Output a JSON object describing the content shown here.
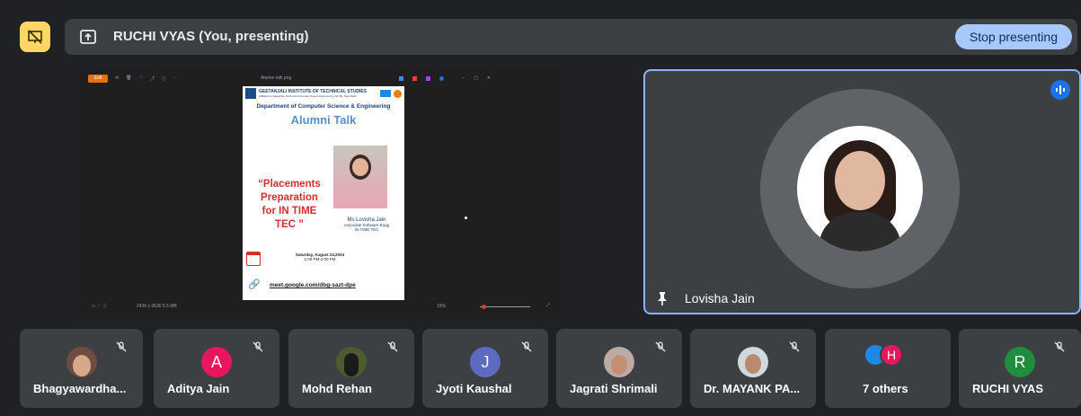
{
  "presentation": {
    "title": "RUCHI VYAS (You, presenting)",
    "stop_label": "Stop presenting"
  },
  "viewer": {
    "filename": "Alumni talk.png",
    "edit_label": "Edit",
    "zoom": "19%",
    "info": "2436 x 3630   5.5 MB"
  },
  "poster": {
    "institute": "GEETANJALI INSTITUTE OF TECHNICAL STUDIES",
    "institute_sub": "Affiliated to Rajasthan Technical University Kota & Approved by AICTE, New Delhi",
    "department": "Department of Computer Science & Engineering",
    "heading": "Alumni Talk",
    "topic_lines": [
      "“Placements",
      "Preparation",
      "for IN TIME",
      "TEC ”"
    ],
    "speaker_name": "Ms Lovisha Jain",
    "speaker_role": "Associate Software Engg",
    "speaker_company": "IN-TIME TEC",
    "date": "Saturday, August 24,2024",
    "time": "1:00 PM-2:00 PM",
    "link": "meet.google.com/dbg-sazt-dpe"
  },
  "speaker": {
    "name": "Lovisha Jain"
  },
  "participants": [
    {
      "name": "Bhagyawardha...",
      "avatar": "photo",
      "color": "#6d4c41"
    },
    {
      "name": "Aditya Jain",
      "avatar": "A",
      "color": "#e8175d"
    },
    {
      "name": "Mohd Rehan",
      "avatar": "photo",
      "color": "#4e5b31"
    },
    {
      "name": "Jyoti Kaushal",
      "avatar": "J",
      "color": "#5c6bc0"
    },
    {
      "name": "Jagrati Shrimali",
      "avatar": "photo",
      "color": "#8d6e63"
    },
    {
      "name": "Dr. MAYANK PA...",
      "avatar": "photo",
      "color": "#78909c"
    },
    {
      "name": "7 others",
      "avatar": "H",
      "color": "#e8175d"
    },
    {
      "name": "RUCHI VYAS",
      "avatar": "R",
      "color": "#1e8e3e"
    }
  ],
  "colors": {
    "accent": "#8ab4f8",
    "stop_button": "#a8c7fa",
    "background": "#202124",
    "tile": "#3c4043"
  }
}
